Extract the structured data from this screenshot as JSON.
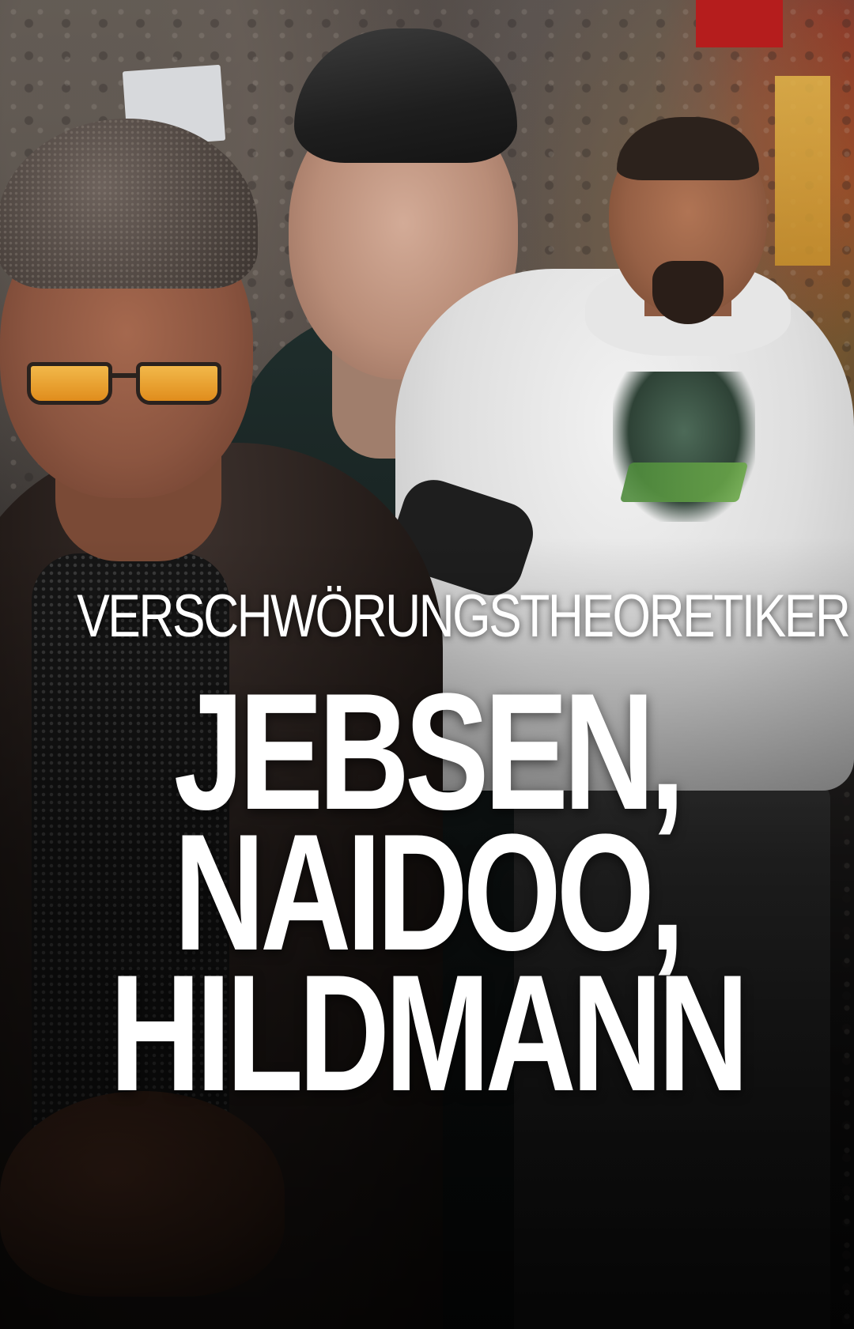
{
  "poster": {
    "kicker": "VERSCHWÖRUNGSTHEORETIKER",
    "headline_lines": [
      "JEBSEN,",
      "NAIDOO,",
      "HILDMANN"
    ]
  },
  "colors": {
    "text": "#ffffff",
    "glasses_lens": "#f2b84a",
    "background": "#1a1a1a"
  }
}
